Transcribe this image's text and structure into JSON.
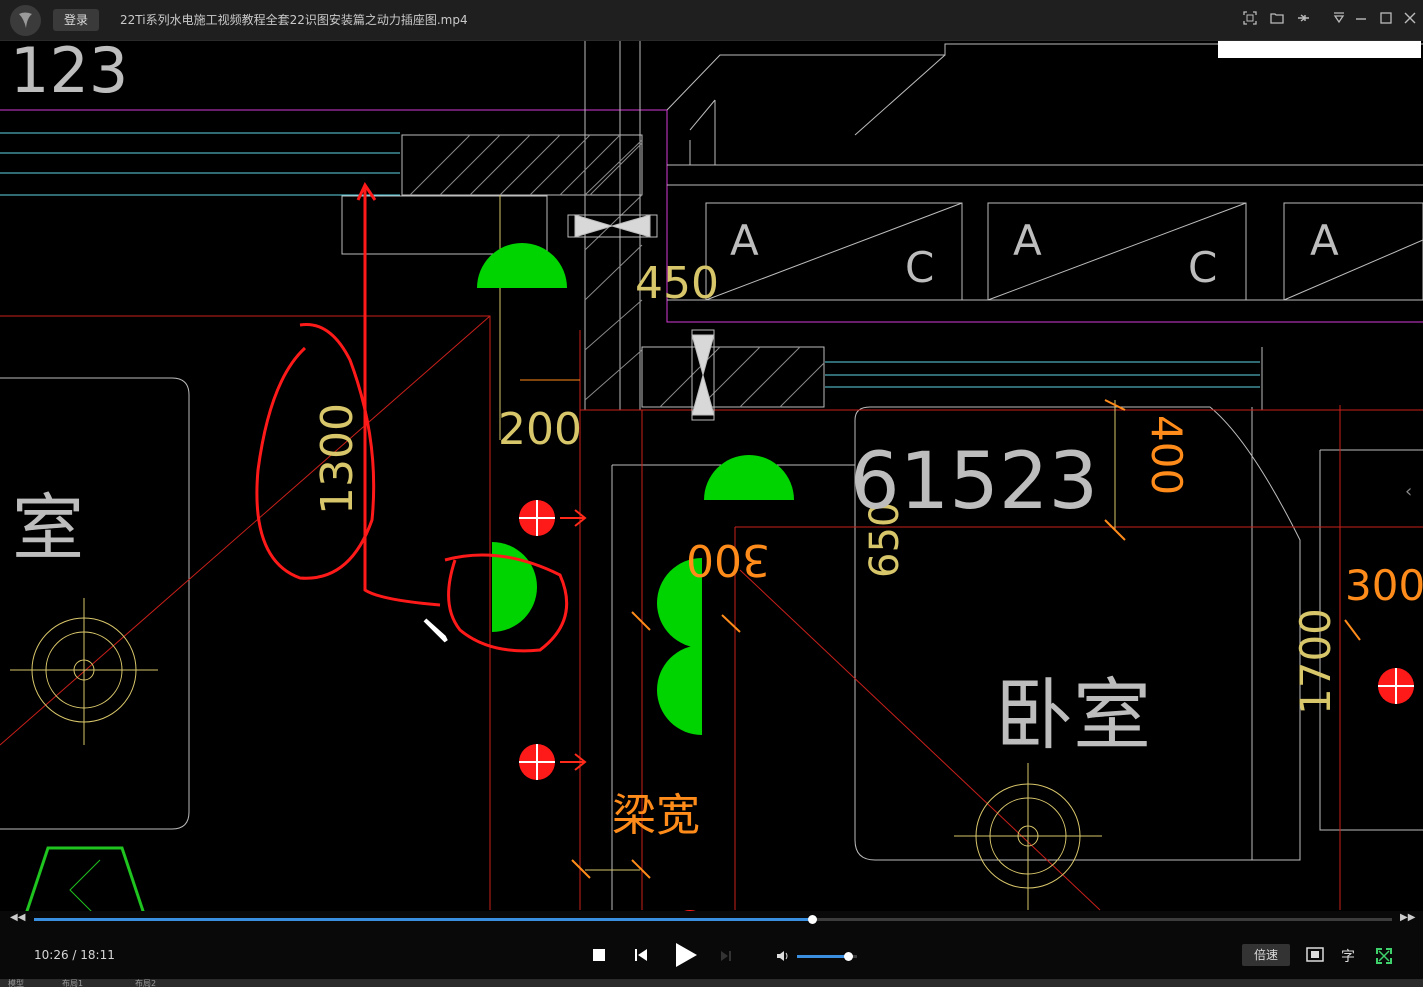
{
  "titlebar": {
    "login_label": "登录",
    "file_title": "22Ti系列水电施工视频教程全套22识图安装篇之动力插座图.mp4",
    "icons": [
      "screenshot-icon",
      "folder-icon",
      "pin-icon",
      "menu-icon",
      "minimize-icon",
      "maximize-icon",
      "close-icon"
    ]
  },
  "cad": {
    "labels": {
      "top_left_number": "123",
      "dim_450": "450",
      "dim_200": "200",
      "dim_1300": "1300",
      "dim_300": "300",
      "dim_650": "650",
      "room_number": "61523",
      "dim_400": "400",
      "dim_1700": "1700",
      "dim_300_right": "300",
      "room_left": "室",
      "room_bedroom": "卧室",
      "beam_width": "梁宽",
      "panel_a": "A",
      "panel_c": "C"
    },
    "colors": {
      "red": "#ff2a1a",
      "green": "#00d400",
      "yellow": "#d8c66a",
      "cyan": "#5fd6e6",
      "magenta": "#d43ad4",
      "orange": "#ff8c1a",
      "gray": "#bdbdbd"
    }
  },
  "player": {
    "time_current": "10:26",
    "time_total": "18:11",
    "time_display": "10:26 / 18:11",
    "progress": 0.573,
    "volume": 0.85,
    "speed_label": "倍速",
    "subtitle_label": "字",
    "accent": "#3b8fe0"
  },
  "statusbar": {
    "items": [
      "模型",
      "布局1",
      "布局2"
    ]
  }
}
